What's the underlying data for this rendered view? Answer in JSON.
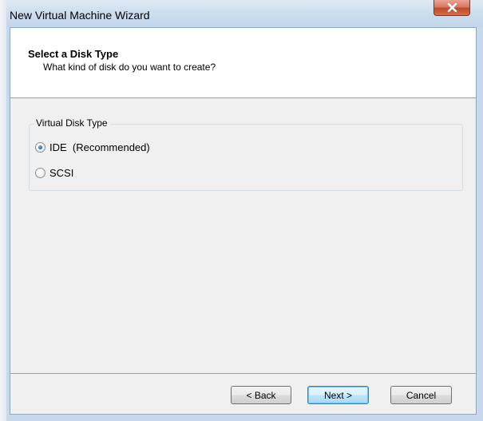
{
  "window": {
    "title": "New Virtual Machine Wizard",
    "close_icon": "close-icon"
  },
  "header": {
    "title": "Select a Disk Type",
    "subtitle": "What kind of disk do you want to create?"
  },
  "disk_type_group": {
    "legend": "Virtual Disk Type",
    "options": [
      {
        "label": "IDE  (Recommended)",
        "selected": true
      },
      {
        "label": "SCSI",
        "selected": false
      }
    ]
  },
  "buttons": {
    "back": "< Back",
    "next": "Next >",
    "cancel": "Cancel"
  },
  "colors": {
    "accent": "#3c7fb1",
    "titlebar": "#c9dbee",
    "close": "#c2482a"
  }
}
